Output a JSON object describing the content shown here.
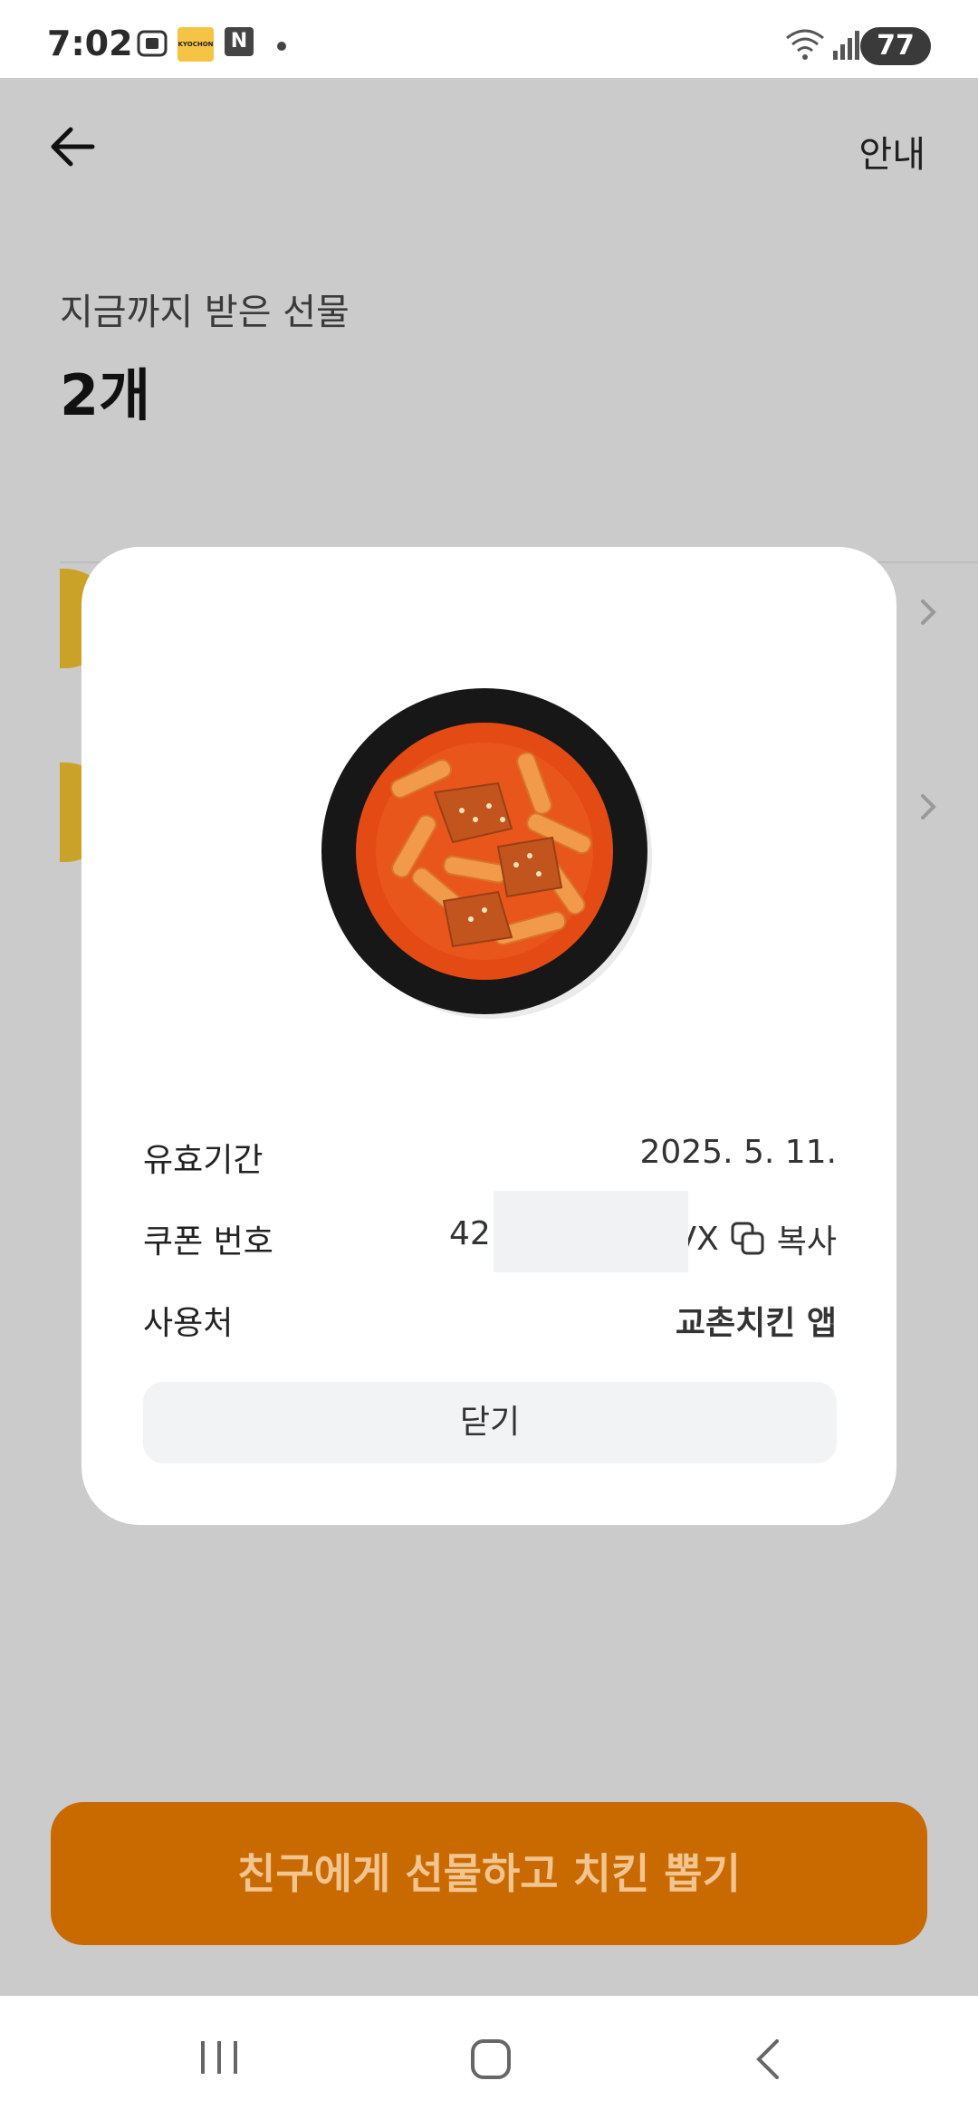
{
  "status_bar": {
    "time": "7:02",
    "battery": "77",
    "app_icon_kyochon": "KYOCHON",
    "app_icon_n": "N"
  },
  "header": {
    "guide_label": "안내"
  },
  "summary": {
    "received_label": "지금까지 받은 선물",
    "received_count": "2개"
  },
  "modal": {
    "validity_label": "유효기간",
    "validity_value": "2025. 5. 11.",
    "coupon_label": "쿠폰 번호",
    "coupon_value_prefix": "42",
    "coupon_value_suffix": "VX",
    "copy_label": "복사",
    "usage_label": "사용처",
    "usage_value": "교촌치킨 앱",
    "close_label": "닫기"
  },
  "cta": {
    "label": "친구에게 선물하고 치킨 뽑기"
  },
  "colors": {
    "accent": "#c86a00",
    "overlay": "#cbcbcb"
  }
}
